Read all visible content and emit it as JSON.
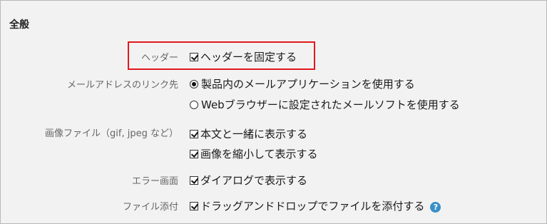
{
  "section": {
    "title": "全般"
  },
  "header_setting": {
    "label": "ヘッダー",
    "option": {
      "text": "ヘッダーを固定する",
      "checked": true
    }
  },
  "mail_link_setting": {
    "label": "メールアドレスのリンク先",
    "options": [
      {
        "text": "製品内のメールアプリケーションを使用する",
        "selected": true
      },
      {
        "text": "Webブラウザーに設定されたメールソフトを使用する",
        "selected": false
      }
    ]
  },
  "image_file_setting": {
    "label": "画像ファイル（gif, jpeg など）",
    "options": [
      {
        "text": "本文と一緒に表示する",
        "checked": true
      },
      {
        "text": "画像を縮小して表示する",
        "checked": true
      }
    ]
  },
  "error_screen_setting": {
    "label": "エラー画面",
    "option": {
      "text": "ダイアログで表示する",
      "checked": true
    }
  },
  "file_attach_setting": {
    "label": "ファイル添付",
    "option": {
      "text": "ドラッグアンドドロップでファイルを添付する",
      "checked": true
    },
    "help_icon": "?"
  },
  "colors": {
    "highlight_border": "#e0191f",
    "help_icon": "#3a8fc8",
    "panel_bg": "#f2f2f2",
    "label_text": "#666666"
  }
}
